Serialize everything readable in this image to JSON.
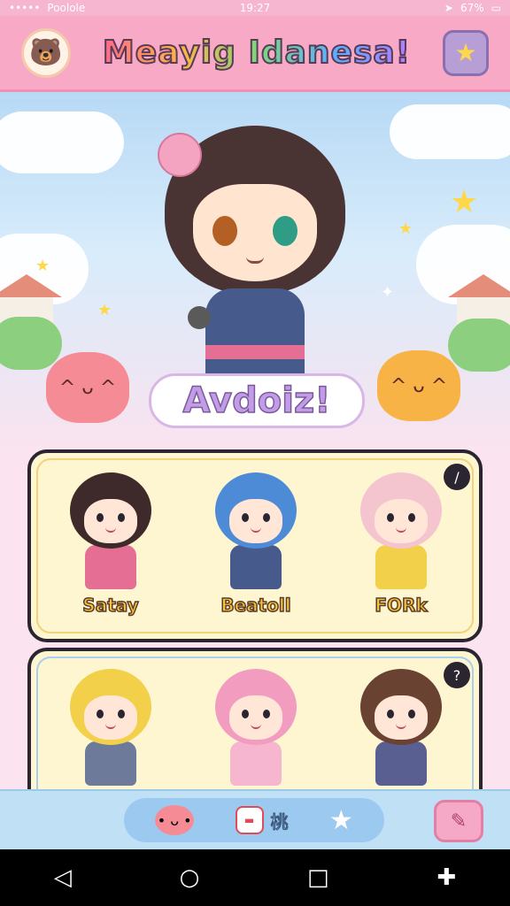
{
  "status_bar": {
    "carrier": "Poolole",
    "time": "19:27",
    "battery": "67%"
  },
  "header": {
    "title": "Meayig Idanesa!",
    "avatar_icon": "bear-icon",
    "star_icon": "star-icon"
  },
  "hero": {
    "banner_text": "Avdoiz!"
  },
  "characters_row1": [
    {
      "name": "Satay",
      "hair": "#3e2a2a",
      "outfit": "#e56e95"
    },
    {
      "name": "Beatoll",
      "hair": "#4d8bd6",
      "outfit": "#465a8c"
    },
    {
      "name": "FORk",
      "hair": "#f4c4cf",
      "outfit": "#f2d04a"
    }
  ],
  "characters_row2": [
    {
      "hair": "#f2d04a",
      "outfit": "#6d7a9a"
    },
    {
      "hair": "#f29cc0",
      "outfit": "#f7b6cf"
    },
    {
      "hair": "#6a4232",
      "outfit": "#5a5f92"
    }
  ],
  "bottom_nav": {
    "card_label": "桃",
    "card_icon_text": "▬"
  },
  "colors": {
    "accent_pink": "#f8a9c6",
    "accent_blue": "#bfe0f5",
    "card_bg": "#fdf6d0"
  }
}
